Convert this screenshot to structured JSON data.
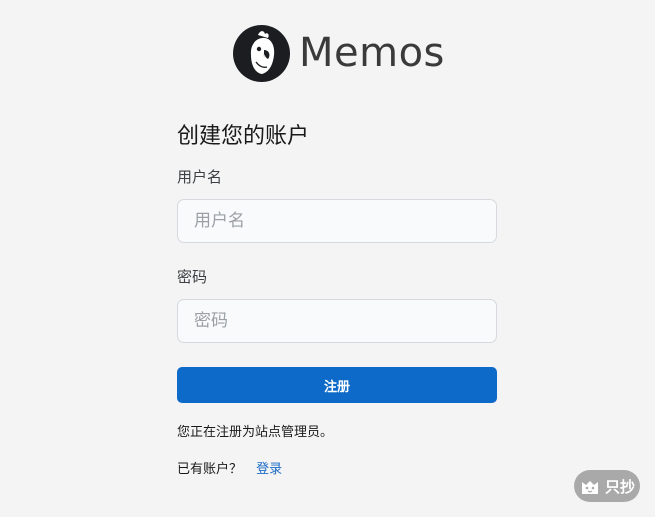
{
  "brand": {
    "name": "Memos",
    "logo_icon": "cockatoo-logo-icon"
  },
  "form": {
    "title": "创建您的账户",
    "username": {
      "label": "用户名",
      "placeholder": "用户名",
      "value": ""
    },
    "password": {
      "label": "密码",
      "placeholder": "密码",
      "value": ""
    },
    "submit_label": "注册",
    "admin_note": "您正在注册为站点管理员。",
    "has_account_text": "已有账户？",
    "login_link_label": "登录"
  },
  "watermark": {
    "text": "只抄",
    "icon": "cat-icon"
  },
  "colors": {
    "background": "#f4f4f4",
    "primary_button": "#0d6ac9",
    "link": "#1d6cc7",
    "input_background": "#f9fafb",
    "input_border": "#d6d9de"
  }
}
